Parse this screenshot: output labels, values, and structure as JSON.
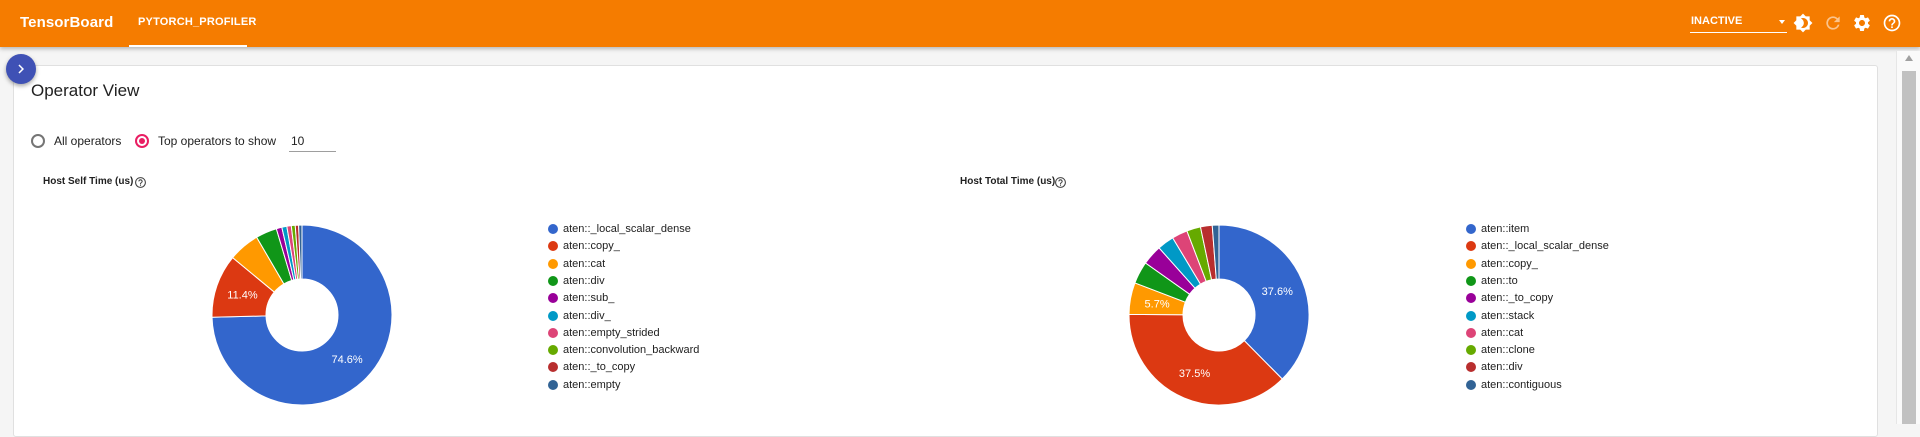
{
  "app": {
    "title": "TensorBoard",
    "active_tab": "PYTORCH_PROFILER",
    "run_selector": "INACTIVE",
    "icons": [
      "sidebar-toggle-icon",
      "theme-toggle-icon",
      "refresh-icon",
      "settings-icon",
      "help-icon"
    ]
  },
  "colors": {
    "toolbar": "#f57c00",
    "accent": "#e91e63",
    "sidebar_toggle": "#3f51b5"
  },
  "view": {
    "title": "Operator View",
    "all_operators_label": "All operators",
    "top_operators_label": "Top operators to show",
    "top_n_value": "10",
    "selected_mode": "top"
  },
  "chart_data": [
    {
      "type": "pie",
      "title": "Host Self Time (us)",
      "donut": true,
      "legend_position": "right",
      "labels": [
        "aten::_local_scalar_dense",
        "aten::copy_",
        "aten::cat",
        "aten::div",
        "aten::sub_",
        "aten::div_",
        "aten::empty_strided",
        "aten::convolution_backward",
        "aten::_to_copy",
        "aten::empty"
      ],
      "values": [
        74.6,
        11.4,
        5.6,
        3.8,
        1.0,
        0.9,
        0.8,
        0.7,
        0.6,
        0.6
      ],
      "slice_labels": [
        "74.6%",
        "11.4%",
        "",
        "",
        "",
        "",
        "",
        "",
        "",
        ""
      ],
      "colors": [
        "#3366cc",
        "#dc3912",
        "#ff9900",
        "#109618",
        "#990099",
        "#0099c6",
        "#dd4477",
        "#66aa00",
        "#b82e2e",
        "#316395"
      ]
    },
    {
      "type": "pie",
      "title": "Host Total Time (us)",
      "donut": true,
      "legend_position": "right",
      "labels": [
        "aten::item",
        "aten::_local_scalar_dense",
        "aten::copy_",
        "aten::to",
        "aten::_to_copy",
        "aten::stack",
        "aten::cat",
        "aten::clone",
        "aten::div",
        "aten::contiguous"
      ],
      "values": [
        37.6,
        37.5,
        5.7,
        4.0,
        3.6,
        3.0,
        2.8,
        2.5,
        2.1,
        1.2
      ],
      "slice_labels": [
        "37.6%",
        "37.5%",
        "5.7%",
        "",
        "",
        "",
        "",
        "",
        "",
        ""
      ],
      "colors": [
        "#3366cc",
        "#dc3912",
        "#ff9900",
        "#109618",
        "#990099",
        "#0099c6",
        "#dd4477",
        "#66aa00",
        "#b82e2e",
        "#316395"
      ]
    }
  ]
}
